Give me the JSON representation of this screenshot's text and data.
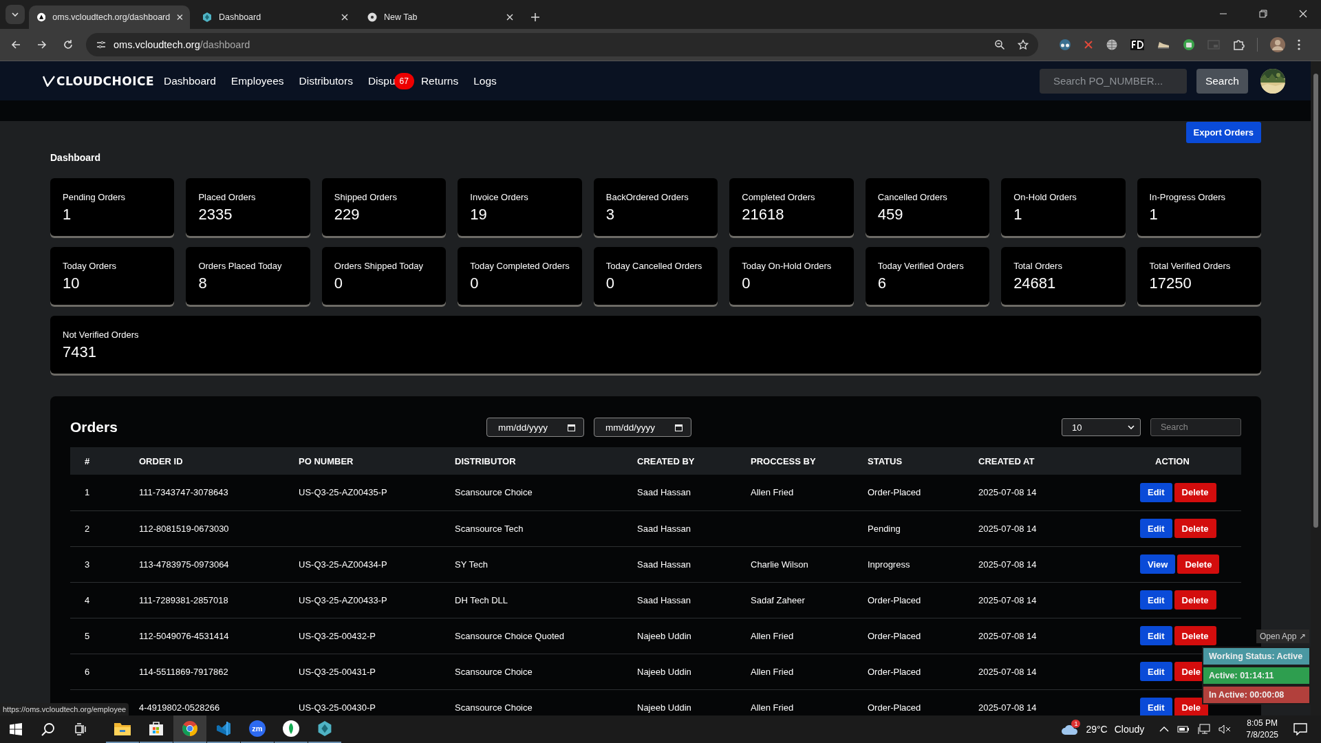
{
  "browser": {
    "tabs": [
      {
        "title": "oms.vcloudtech.org/dashboard",
        "kind": "site",
        "selected": true
      },
      {
        "title": "Dashboard",
        "kind": "app",
        "selected": false
      },
      {
        "title": "New Tab",
        "kind": "chrome",
        "selected": false
      }
    ],
    "address": {
      "host": "oms.vcloudtech.org",
      "path": "/dashboard"
    }
  },
  "navbar": {
    "logo": "CLOUDCHOICE",
    "links": [
      {
        "label": "Dashboard"
      },
      {
        "label": "Employees"
      },
      {
        "label": "Distributors"
      },
      {
        "label": "Dispu",
        "badge": "67"
      },
      {
        "label": "Returns"
      },
      {
        "label": "Logs"
      }
    ],
    "search": {
      "placeholder": "Search PO_NUMBER..."
    },
    "search_button": "Search"
  },
  "export_button": "Export Orders",
  "dashboard_title": "Dashboard",
  "stats": [
    {
      "label": "Pending Orders",
      "value": "1"
    },
    {
      "label": "Placed Orders",
      "value": "2335"
    },
    {
      "label": "Shipped Orders",
      "value": "229"
    },
    {
      "label": "Invoice Orders",
      "value": "19"
    },
    {
      "label": "BackOrdered Orders",
      "value": "3"
    },
    {
      "label": "Completed Orders",
      "value": "21618"
    },
    {
      "label": "Cancelled Orders",
      "value": "459"
    },
    {
      "label": "On-Hold Orders",
      "value": "1"
    },
    {
      "label": "In-Progress Orders",
      "value": "1"
    },
    {
      "label": "Today Orders",
      "value": "10"
    },
    {
      "label": "Orders Placed Today",
      "value": "8"
    },
    {
      "label": "Orders Shipped Today",
      "value": "0"
    },
    {
      "label": "Today Completed Orders",
      "value": "0"
    },
    {
      "label": "Today Cancelled Orders",
      "value": "0"
    },
    {
      "label": "Today On-Hold Orders",
      "value": "0"
    },
    {
      "label": "Today Verified Orders",
      "value": "6"
    },
    {
      "label": "Total Orders",
      "value": "24681"
    },
    {
      "label": "Total Verified Orders",
      "value": "17250"
    },
    {
      "label": "Not Verified Orders",
      "value": "7431"
    }
  ],
  "orders": {
    "title": "Orders",
    "date_from": {
      "placeholder": "mm/dd/yyyy"
    },
    "date_to": {
      "placeholder": "mm/dd/yyyy"
    },
    "page_size": "10",
    "search": {
      "placeholder": "Search"
    },
    "columns": [
      "#",
      "ORDER ID",
      "PO NUMBER",
      "DISTRIBUTOR",
      "CREATED BY",
      "PROCCESS BY",
      "STATUS",
      "CREATED AT",
      "ACTION"
    ],
    "rows": [
      {
        "num": "1",
        "order_id": "111-7343747-3078643",
        "po_number": "US-Q3-25-AZ00435-P",
        "distributor": "Scansource Choice",
        "created_by": "Saad Hassan",
        "process_by": "Allen Fried",
        "status": "Order-Placed",
        "created_at": "2025-07-08 14",
        "actions": [
          {
            "label": "Edit",
            "kind": "primary"
          },
          {
            "label": "Delete",
            "kind": "danger"
          }
        ]
      },
      {
        "num": "2",
        "order_id": "112-8081519-0673030",
        "distributor": "Scansource Tech",
        "created_by": "Saad Hassan",
        "status": "Pending",
        "created_at": "2025-07-08 14",
        "actions": [
          {
            "label": "Edit",
            "kind": "primary"
          },
          {
            "label": "Delete",
            "kind": "danger"
          }
        ]
      },
      {
        "num": "3",
        "order_id": "113-4783975-0973064",
        "po_number": "US-Q3-25-AZ00434-P",
        "distributor": "SY Tech",
        "created_by": "Saad Hassan",
        "process_by": "Charlie Wilson",
        "status": "Inprogress",
        "created_at": "2025-07-08 14",
        "actions": [
          {
            "label": "View",
            "kind": "primary"
          },
          {
            "label": "Delete",
            "kind": "danger"
          }
        ]
      },
      {
        "num": "4",
        "order_id": "111-7289381-2857018",
        "po_number": "US-Q3-25-AZ00433-P",
        "distributor": "DH Tech DLL",
        "created_by": "Saad Hassan",
        "process_by": "Sadaf Zaheer",
        "status": "Order-Placed",
        "created_at": "2025-07-08 14",
        "actions": [
          {
            "label": "Edit",
            "kind": "primary"
          },
          {
            "label": "Delete",
            "kind": "danger"
          }
        ]
      },
      {
        "num": "5",
        "order_id": "112-5049076-4531414",
        "po_number": "US-Q3-25-00432-P",
        "distributor": "Scansource Choice Quoted",
        "created_by": "Najeeb Uddin",
        "process_by": "Allen Fried",
        "status": "Order-Placed",
        "created_at": "2025-07-08 14",
        "actions": [
          {
            "label": "Edit",
            "kind": "primary"
          },
          {
            "label": "Delete",
            "kind": "danger"
          }
        ]
      },
      {
        "num": "6",
        "order_id": "114-5511869-7917862",
        "po_number": "US-Q3-25-00431-P",
        "distributor": "Scansource Choice",
        "created_by": "Najeeb Uddin",
        "process_by": "Allen Fried",
        "status": "Order-Placed",
        "created_at": "2025-07-08 14",
        "actions": [
          {
            "label": "Edit",
            "kind": "primary"
          },
          {
            "label": "Dele",
            "kind": "danger"
          }
        ]
      },
      {
        "order_id": "4-4919802-0528266",
        "po_number": "US-Q3-25-00430-P",
        "distributor": "Scansource Choice",
        "created_by": "Najeeb Uddin",
        "process_by": "Allen Fried",
        "status": "Order-Placed",
        "created_at": "2025-07-08 14",
        "actions": [
          {
            "label": "Edit",
            "kind": "primary"
          },
          {
            "label": "Dele",
            "kind": "danger"
          }
        ]
      }
    ]
  },
  "status_link": "https://oms.vcloudtech.org/employee",
  "widget": {
    "open_app": "Open App ↗",
    "lines": [
      {
        "text": "Working Status: Active",
        "color": "#4a98a2"
      },
      {
        "text": "Active: 01:14:11",
        "color": "#2e9e4f"
      },
      {
        "text": "In Active: 00:00:08",
        "color": "#b2403c"
      }
    ]
  },
  "taskbar": {
    "apps": [
      {
        "kind": "files",
        "selected": false
      },
      {
        "kind": "store",
        "selected": false
      },
      {
        "kind": "chrome",
        "selected": true
      },
      {
        "kind": "code",
        "selected": false
      },
      {
        "kind": "zoom",
        "label": "zm",
        "selected": false
      },
      {
        "kind": "leaf",
        "selected": false
      },
      {
        "kind": "app",
        "selected": false
      }
    ],
    "weather": {
      "badge": "1",
      "temp": "29°C",
      "condition": "Cloudy"
    },
    "clock": {
      "time": "8:05 PM",
      "date": "7/8/2025"
    }
  }
}
